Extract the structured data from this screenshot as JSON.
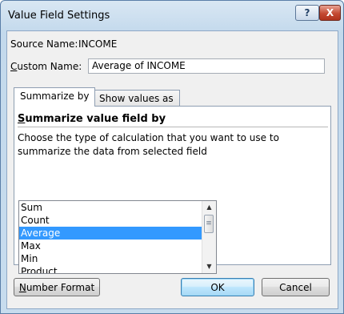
{
  "window": {
    "title": "Value Field Settings",
    "help_glyph": "?",
    "close_glyph": "X"
  },
  "source": {
    "label": "Source Name:",
    "value": "INCOME"
  },
  "custom_name": {
    "label_first": "C",
    "label_rest": "ustom Name:",
    "value": "Average of INCOME"
  },
  "tabs": [
    {
      "label": "Summarize by",
      "active": true
    },
    {
      "label": "Show values as",
      "active": false
    }
  ],
  "summarize": {
    "title_first": "S",
    "title_rest": "ummarize value field by",
    "description": "Choose the type of calculation that you want to use to summarize the data from selected field",
    "items": [
      "Sum",
      "Count",
      "Average",
      "Max",
      "Min",
      "Product"
    ],
    "selected": "Average"
  },
  "buttons": {
    "number_format_first": "N",
    "number_format_rest": "umber Format",
    "ok": "OK",
    "cancel": "Cancel"
  },
  "colors": {
    "selection": "#3399ff",
    "close_button": "#c44a32",
    "frame": "#c7dcee"
  }
}
